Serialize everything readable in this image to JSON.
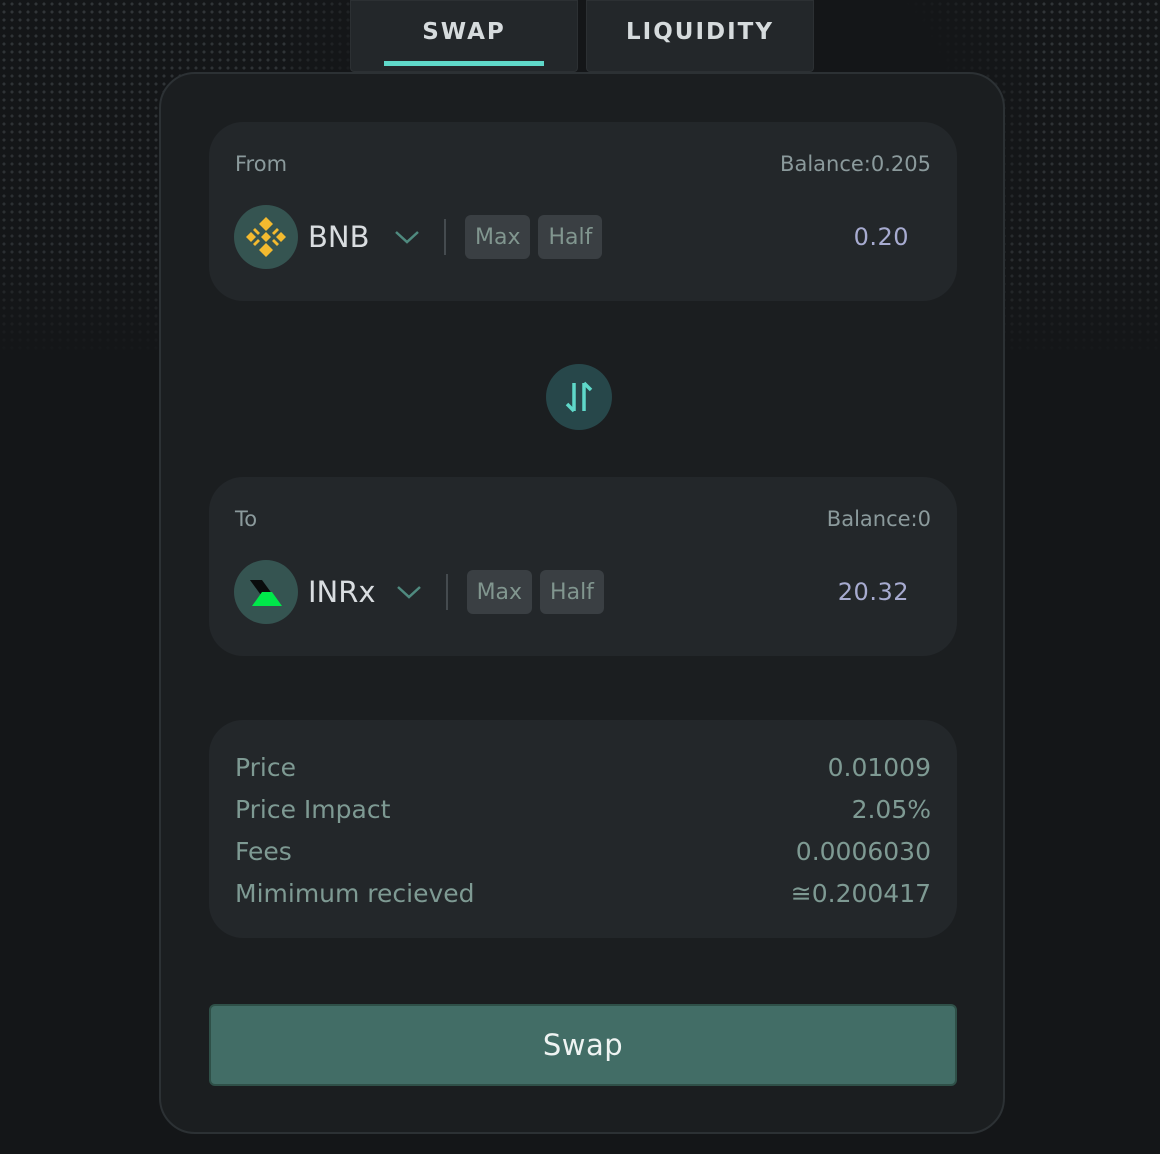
{
  "tabs": [
    {
      "label": "SWAP",
      "active": true
    },
    {
      "label": "LIQUIDITY",
      "active": false
    }
  ],
  "from": {
    "label": "From",
    "balance": "Balance:0.205",
    "token": {
      "symbol": "BNB",
      "icon": "bnb-icon"
    },
    "max_label": "Max",
    "half_label": "Half",
    "amount": "0.20"
  },
  "to": {
    "label": "To",
    "balance": "Balance:0",
    "token": {
      "symbol": "INRx",
      "icon": "inrx-icon"
    },
    "max_label": "Max",
    "half_label": "Half",
    "amount": "20.32"
  },
  "switch_icon": "swap-direction-icon",
  "details": [
    {
      "label": "Price",
      "value": "0.01009"
    },
    {
      "label": "Price Impact",
      "value": "2.05%"
    },
    {
      "label": "Fees",
      "value": "0.0006030"
    },
    {
      "label": "Mimimum recieved",
      "value": "≅0.200417"
    }
  ],
  "swap_button": "Swap",
  "colors": {
    "accent": "#5fd8c9",
    "button": "#426d66",
    "background": "#141618",
    "card": "#1b1e20",
    "panel": "#23272a",
    "bnb": "#f3ba2f",
    "inrx": "#00e84a"
  }
}
